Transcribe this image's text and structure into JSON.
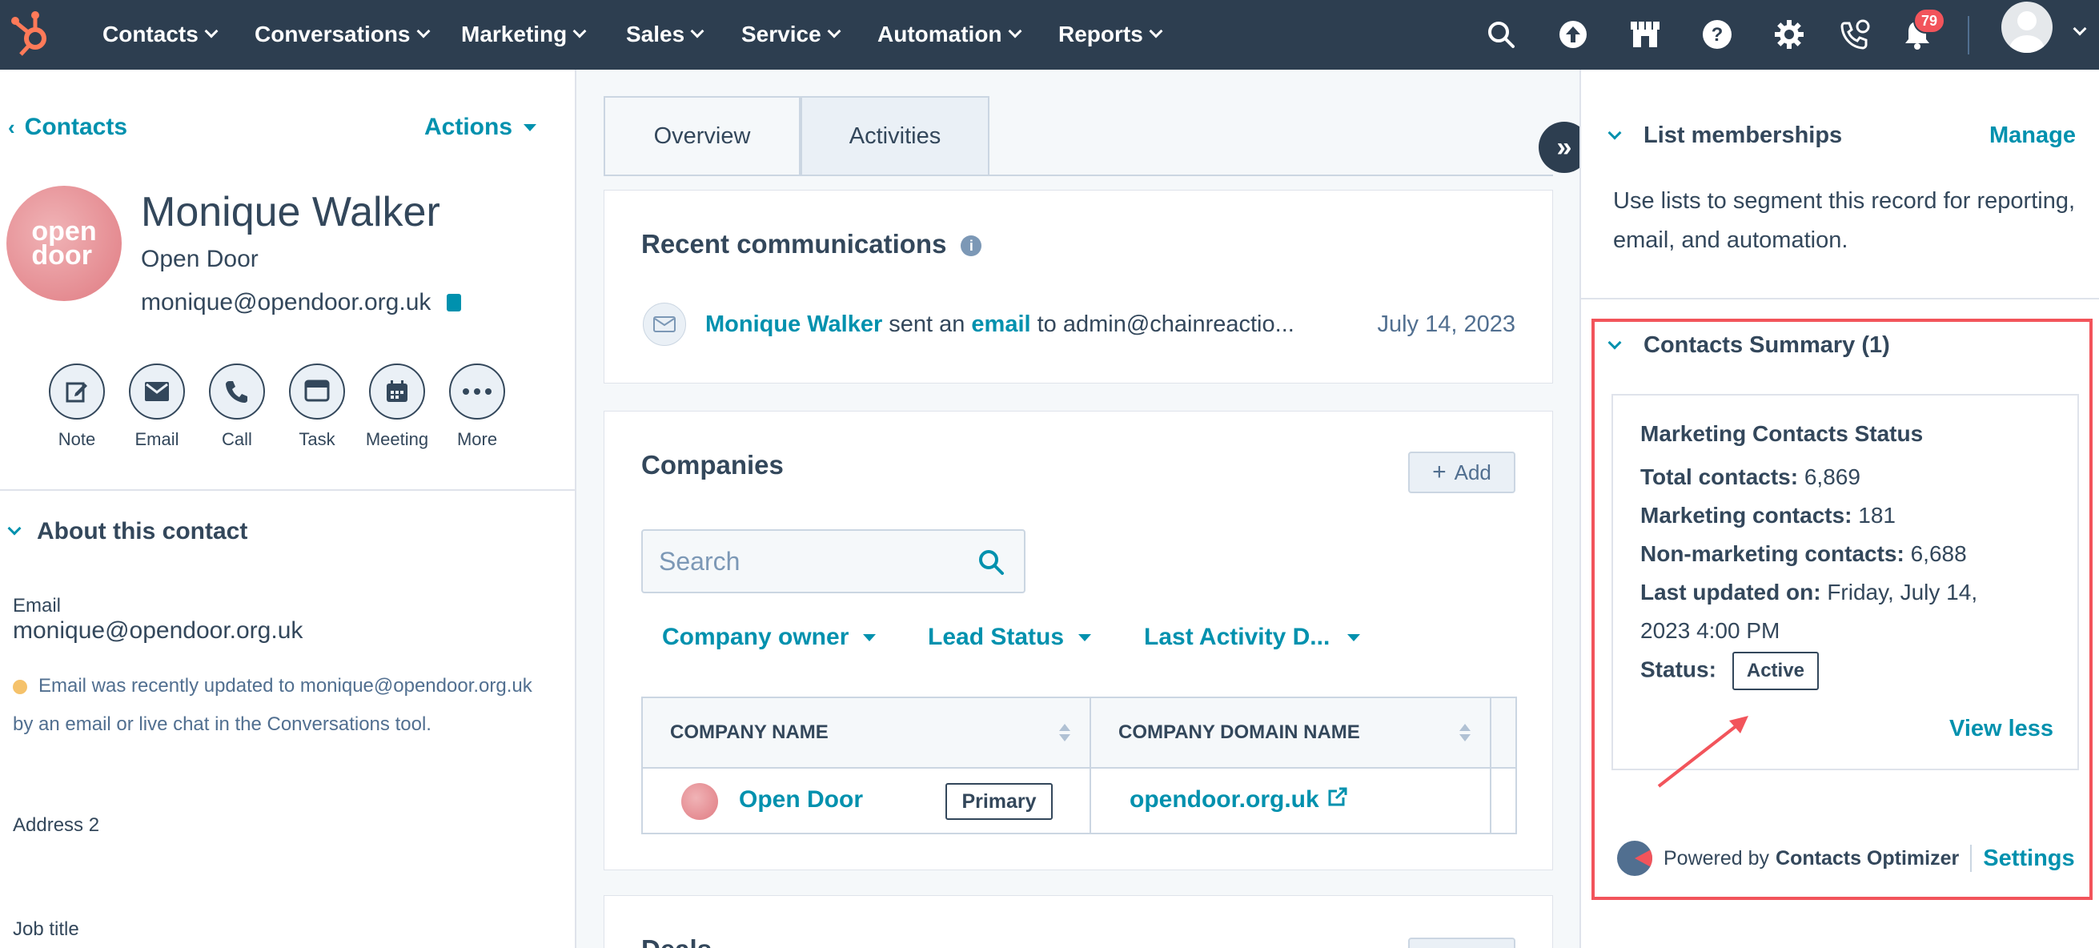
{
  "nav": {
    "items": [
      {
        "label": "Contacts"
      },
      {
        "label": "Conversations"
      },
      {
        "label": "Marketing"
      },
      {
        "label": "Sales"
      },
      {
        "label": "Service"
      },
      {
        "label": "Automation"
      },
      {
        "label": "Reports"
      }
    ],
    "notifications_count": "79",
    "icons": [
      "search-icon",
      "upgrade-icon",
      "marketplace-icon",
      "help-icon",
      "settings-icon",
      "calling-icon",
      "bell-icon"
    ],
    "colors": {
      "background": "#2d3e50",
      "accent": "#ff7a59",
      "badge": "#f2545b"
    }
  },
  "left": {
    "breadcrumb": "Contacts",
    "actions_label": "Actions",
    "logo_text_1": "open",
    "logo_text_2": "door",
    "contact_name": "Monique Walker",
    "company": "Open Door",
    "email": "monique@opendoor.org.uk",
    "quick_actions": [
      {
        "label": "Note"
      },
      {
        "label": "Email"
      },
      {
        "label": "Call"
      },
      {
        "label": "Task"
      },
      {
        "label": "Meeting"
      },
      {
        "label": "More"
      }
    ],
    "about_title": "About this contact",
    "fields": {
      "email_label": "Email",
      "email_value": "monique@opendoor.org.uk",
      "notice": "Email was recently updated to monique@opendoor.org.uk by an email or live chat in the Conversations tool.",
      "address2_label": "Address 2",
      "job_title_label": "Job title"
    }
  },
  "middle": {
    "tabs": [
      {
        "label": "Overview"
      },
      {
        "label": "Activities"
      }
    ],
    "recent": {
      "title": "Recent communications",
      "sender": "Monique Walker",
      "sent_an": "sent an",
      "email_word": "email",
      "to_text": "to admin@chainreactio...",
      "date": "July 14, 2023"
    },
    "companies": {
      "title": "Companies",
      "add_label": "Add",
      "search_placeholder": "Search",
      "filters": [
        {
          "label": "Company owner"
        },
        {
          "label": "Lead Status"
        },
        {
          "label": "Last Activity D..."
        }
      ],
      "columns": [
        "COMPANY NAME",
        "COMPANY DOMAIN NAME"
      ],
      "rows": [
        {
          "name": "Open Door",
          "tag": "Primary",
          "domain": "opendoor.org.uk"
        }
      ]
    },
    "deals_title": "Deals"
  },
  "right": {
    "list_memberships": {
      "title": "List memberships",
      "manage": "Manage",
      "text": "Use lists to segment this record for reporting, email, and automation."
    },
    "summary": {
      "title": "Contacts Summary (1)",
      "card_title": "Marketing Contacts Status",
      "total_label": "Total contacts:",
      "total_value": "6,869",
      "marketing_label": "Marketing contacts:",
      "marketing_value": "181",
      "non_marketing_label": "Non-marketing contacts:",
      "non_marketing_value": "6,688",
      "updated_label": "Last updated on:",
      "updated_value_1": "Friday, July 14,",
      "updated_value_2": "2023 4:00 PM",
      "status_label": "Status:",
      "status_value": "Active",
      "view_less": "View less",
      "powered_by": "Powered by",
      "optimizer": "Contacts Optimizer",
      "settings": "Settings",
      "highlight_color": "#f2545b"
    }
  }
}
